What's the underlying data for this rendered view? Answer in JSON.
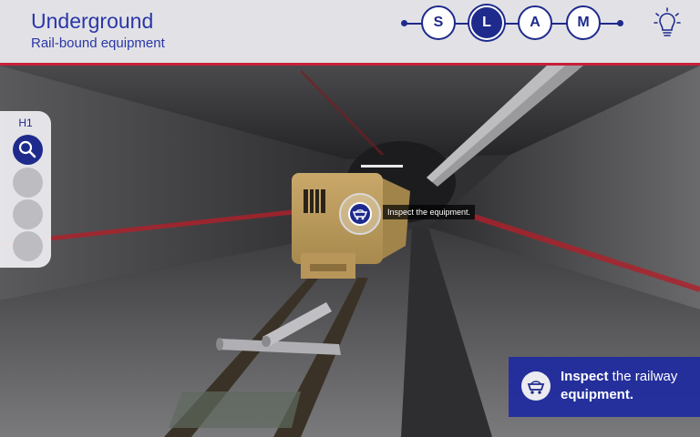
{
  "header": {
    "title": "Underground",
    "subtitle": "Rail-bound equipment"
  },
  "steps": [
    "S",
    "L",
    "A",
    "M"
  ],
  "active_step": "L",
  "sidebar": {
    "label": "H1",
    "items": [
      {
        "icon": "search-icon",
        "active": true
      },
      {
        "icon": "empty",
        "active": false
      },
      {
        "icon": "empty",
        "active": false
      },
      {
        "icon": "empty",
        "active": false
      }
    ]
  },
  "hotspot": {
    "icon": "mine-cart-icon",
    "tooltip": "Inspect the equipment."
  },
  "task": {
    "icon": "mine-cart-icon",
    "bold1": "Inspect",
    "text1": " the railway",
    "bold2": "equipment."
  },
  "colors": {
    "brand_blue": "#1e2a8c",
    "accent_red": "#c8203a",
    "header_bg": "#e8e8ec"
  }
}
